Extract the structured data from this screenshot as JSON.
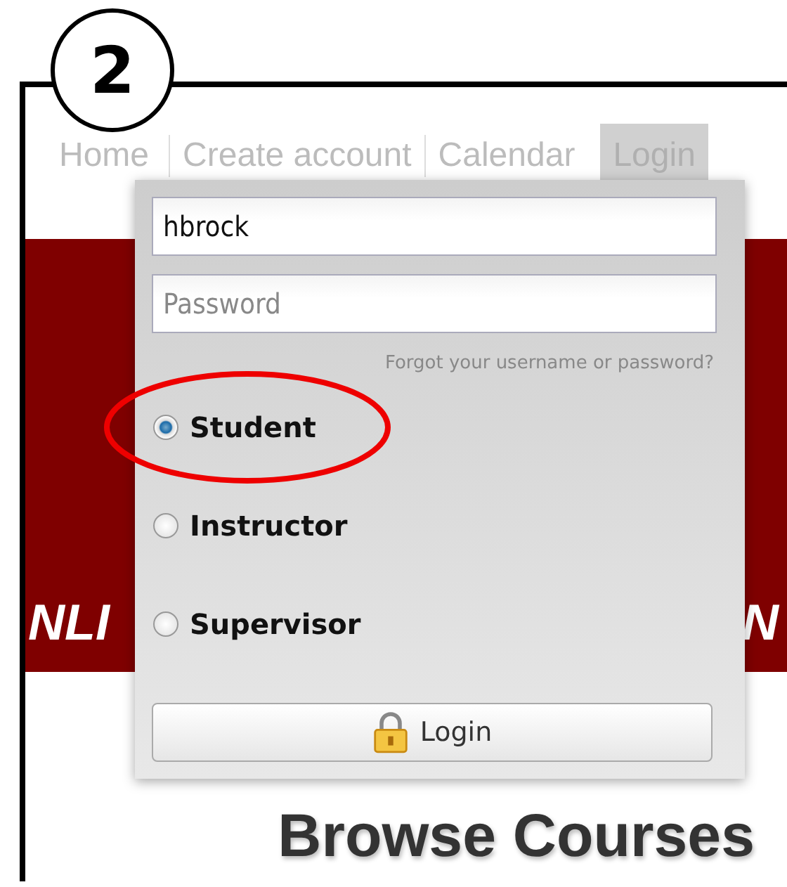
{
  "step_badge": "2",
  "nav": [
    {
      "label": "Home",
      "selected": false
    },
    {
      "label": "Create account",
      "selected": false
    },
    {
      "label": "Calendar",
      "selected": false
    },
    {
      "label": "Login",
      "selected": true
    }
  ],
  "banner": {
    "text_left": "NLI",
    "text_right": "N"
  },
  "login_panel": {
    "username": {
      "value": "hbrock"
    },
    "password": {
      "placeholder": "Password"
    },
    "forgot_link": "Forgot your username or password?",
    "roles": [
      {
        "label": "Student",
        "selected": true,
        "highlighted": true
      },
      {
        "label": "Instructor",
        "selected": false,
        "highlighted": false
      },
      {
        "label": "Supervisor",
        "selected": false,
        "highlighted": false
      }
    ],
    "submit": "Login"
  },
  "heading": "Browse Courses"
}
